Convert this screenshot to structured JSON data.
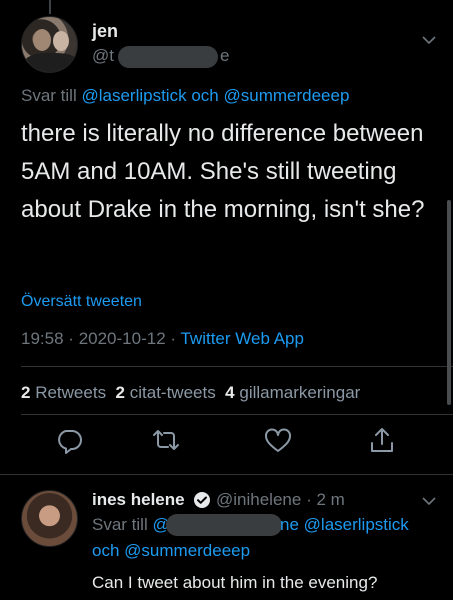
{
  "main_tweet": {
    "author_name": "jen",
    "author_handle_start": "@t",
    "author_handle_end": "e",
    "reply_prefix": "Svar till",
    "reply_mention_1": "@laserlipstick",
    "reply_conjunction": "och",
    "reply_mention_2": "@summerdeeep",
    "text": "there is literally no difference between 5AM and 10AM. She's still tweeting about Drake in the morning, isn't she?",
    "translate_label": "Översätt tweeten",
    "time": "19:58",
    "date": "2020-10-12",
    "separator": "·",
    "source": "Twitter Web App",
    "retweets_count": "2",
    "retweets_label": "Retweets",
    "quotes_count": "2",
    "quotes_label": "citat-tweets",
    "likes_count": "4",
    "likes_label": "gillamarkeringar"
  },
  "reply_tweet": {
    "author_name": "ines helene",
    "author_handle": "@inihelene",
    "time_ago": "· 2 m",
    "reply_prefix": "Svar till",
    "handle_start": "@",
    "handle_end": "ne",
    "mention_1": "@laserlipstick",
    "conjunction": "och",
    "mention_2": "@summerdeeep",
    "text": "Can I tweet about him in the evening?"
  },
  "icons": [
    "chevron-down-icon",
    "reply-icon",
    "retweet-icon",
    "like-icon",
    "share-icon",
    "verified-badge-icon"
  ],
  "colors": {
    "background": "#000000",
    "link": "#1d9bf0",
    "muted": "#6e767d",
    "text": "#e7e9ea"
  }
}
